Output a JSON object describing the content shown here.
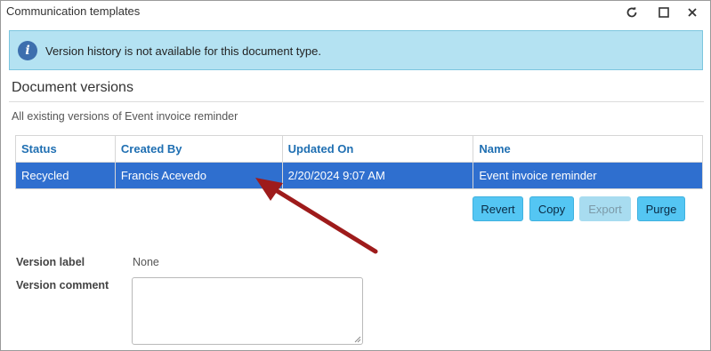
{
  "window": {
    "title": "Communication templates",
    "controls": [
      "refresh-icon",
      "maximize-icon",
      "close-icon"
    ]
  },
  "info_banner": {
    "icon": "info-icon",
    "icon_glyph": "i",
    "text": "Version history is not available for this document type."
  },
  "versions": {
    "title": "Document versions",
    "subtitle": "All existing versions of Event invoice reminder",
    "columns": [
      "Status",
      "Created By",
      "Updated On",
      "Name"
    ],
    "rows": [
      {
        "status": "Recycled",
        "created_by": "Francis Acevedo",
        "updated_on": "2/20/2024 9:07 AM",
        "name": "Event invoice reminder",
        "selected": true
      }
    ],
    "buttons": {
      "revert": "Revert",
      "copy": "Copy",
      "export": "Export",
      "purge": "Purge"
    }
  },
  "details": {
    "version_label_label": "Version label",
    "version_label_value": "None",
    "version_comment_label": "Version comment",
    "version_comment_value": ""
  },
  "colors": {
    "selected_row": "#2f6fcf",
    "header_text": "#1f6fb2",
    "button": "#54c6f3",
    "banner": "#b4e2f2",
    "annotation_arrow": "#9e1b1b"
  }
}
